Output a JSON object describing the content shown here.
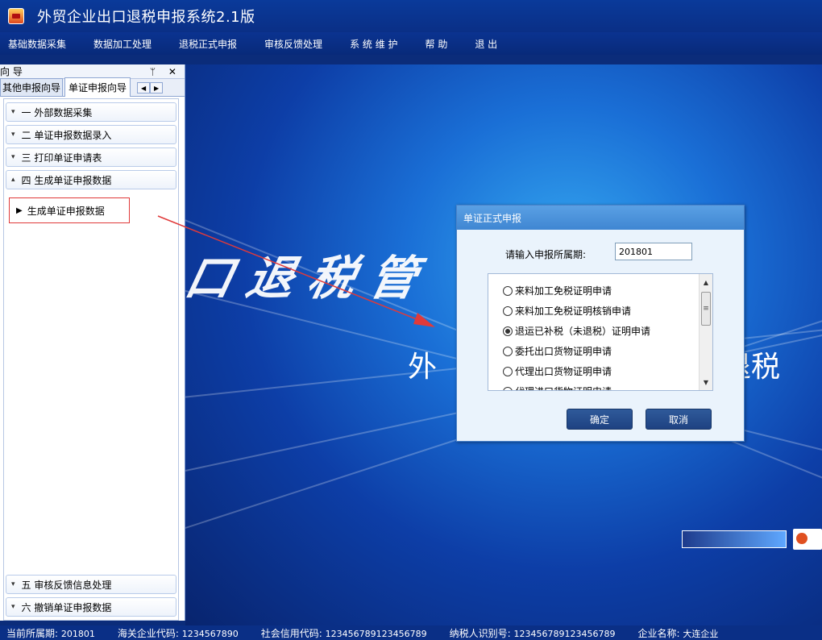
{
  "app": {
    "title": "外贸企业出口退税申报系统2.1版",
    "icon": "app-logo-icon"
  },
  "menu": [
    "基础数据采集",
    "数据加工处理",
    "退税正式申报",
    "审核反馈处理",
    "系 统 维 护",
    "帮 助",
    "退 出"
  ],
  "nav": {
    "header_title": "向 导",
    "header_tools": "ᛘ ✕",
    "tabs": [
      "其他申报向导",
      "单证申报向导"
    ],
    "sections": [
      {
        "label": "一 外部数据采集",
        "caret": "▾"
      },
      {
        "label": "二 单证申报数据录入",
        "caret": "▾"
      },
      {
        "label": "三 打印单证申请表",
        "caret": "▾"
      },
      {
        "label": "四 生成单证申报数据",
        "caret": "▴"
      }
    ],
    "sub_item": "生成单证申报数据",
    "bottom_sections": [
      {
        "label": "五 审核反馈信息处理",
        "caret": "▾"
      },
      {
        "label": "六 撤销单证申报数据",
        "caret": "▾"
      }
    ]
  },
  "background": {
    "text1": "口退税管",
    "text2": "外",
    "text3": "退税"
  },
  "dialog": {
    "title": "单证正式申报",
    "period_label": "请输入申报所属期:",
    "period_value": "201801",
    "options": [
      {
        "label": "来料加工免税证明申请",
        "selected": false
      },
      {
        "label": "来料加工免税证明核销申请",
        "selected": false
      },
      {
        "label": "退运已补税（未退税）证明申请",
        "selected": true
      },
      {
        "label": "委托出口货物证明申请",
        "selected": false
      },
      {
        "label": "代理出口货物证明申请",
        "selected": false
      },
      {
        "label": "代理进口货物证明申请",
        "selected": false
      }
    ],
    "ok_label": "确定",
    "cancel_label": "取消"
  },
  "status": [
    {
      "label": "当前所属期:",
      "value": "201801"
    },
    {
      "label": "海关企业代码:",
      "value": "1234567890"
    },
    {
      "label": "社会信用代码:",
      "value": "123456789123456789"
    },
    {
      "label": "纳税人识别号:",
      "value": "123456789123456789"
    },
    {
      "label": "企业名称:",
      "value": "大连企业"
    }
  ],
  "colors": {
    "accent": "#3f86d2",
    "annotation": "#e03a3a",
    "chrome": "#0a2f86"
  }
}
